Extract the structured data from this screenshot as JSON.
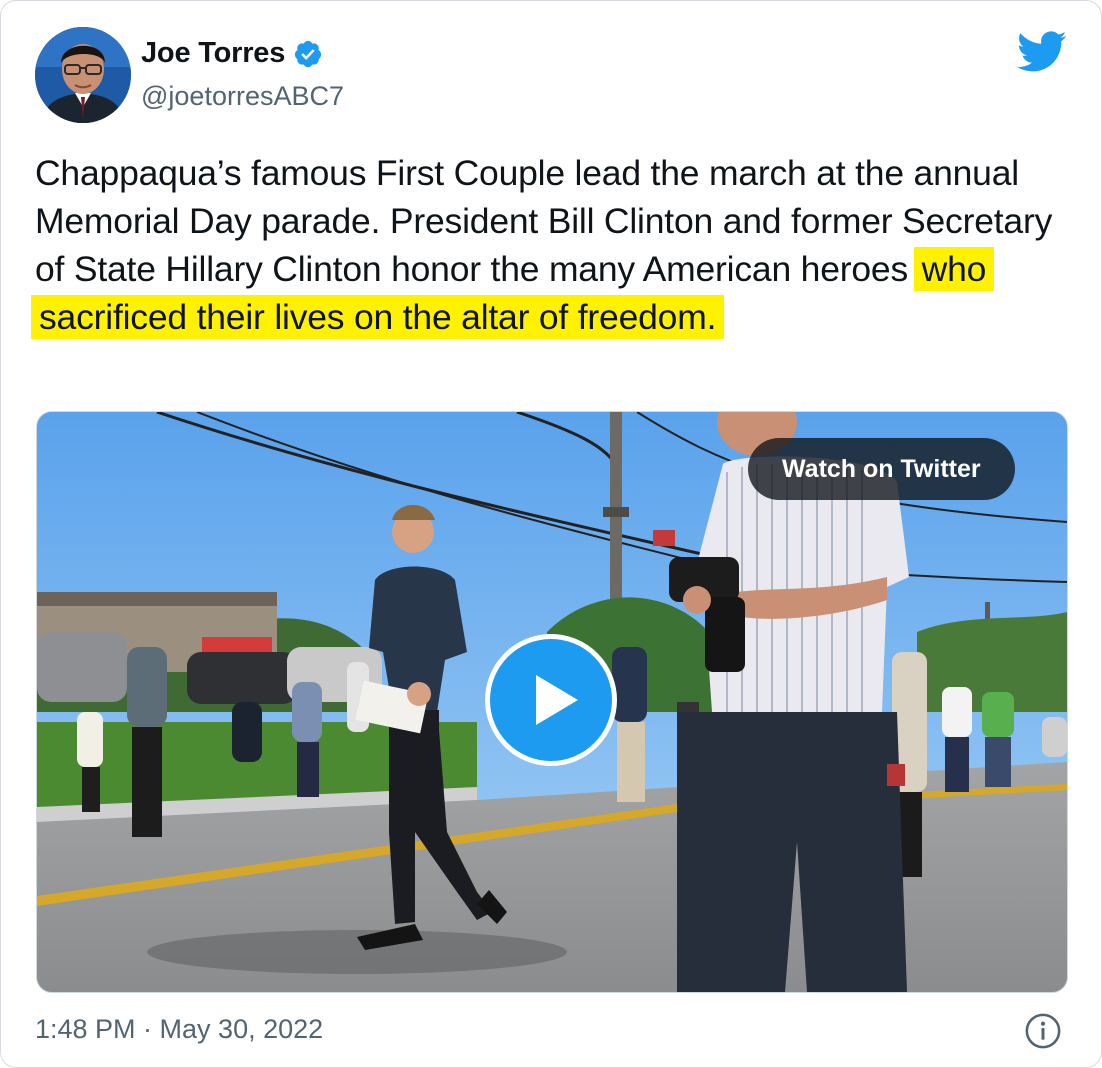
{
  "author": {
    "display_name": "Joe Torres",
    "handle": "@joetorresABC7",
    "verified_icon": "verified-badge-icon",
    "avatar_icon": "profile-photo"
  },
  "brand": {
    "icon": "twitter-bird-icon",
    "color": "#1d9bf0"
  },
  "tweet": {
    "text_plain": "Chappaqua’s famous First Couple lead the march at the annual Memorial Day parade. President Bill Clinton and former Secretary of State Hillary Clinton honor the many American heroes ",
    "text_highlighted": "who sacrificed their lives on the altar of freedom.",
    "highlight_color": "#fff200"
  },
  "media": {
    "type": "video",
    "watch_label": "Watch on Twitter",
    "play_icon": "play-icon"
  },
  "footer": {
    "timestamp": "1:48 PM · May 30, 2022",
    "info_icon": "info-icon"
  },
  "colors": {
    "text": "#0f1419",
    "secondary_text": "#536471",
    "border": "#d6dbdf"
  }
}
